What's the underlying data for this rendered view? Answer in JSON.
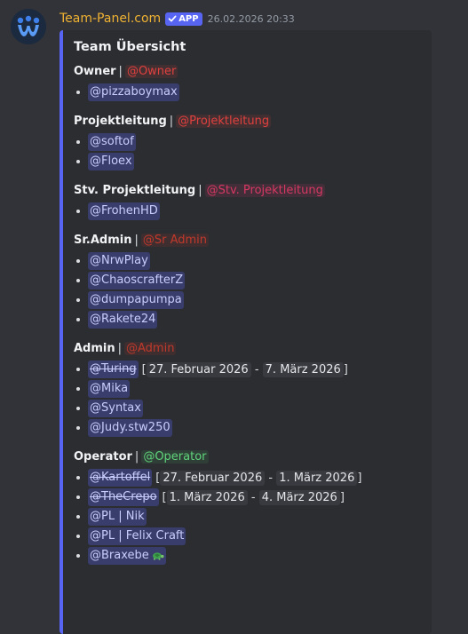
{
  "message": {
    "username": "Team-Panel.com",
    "app_badge": "APP",
    "timestamp": "26.02.2026 20:33"
  },
  "embed": {
    "title": "Team Übersicht",
    "accent_color": "#5865f2",
    "sections": [
      {
        "name": "Owner",
        "separator": "|",
        "role": "@Owner",
        "role_color": "#e0413f",
        "members": [
          {
            "mention": "@pizzaboymax"
          }
        ]
      },
      {
        "name": "Projektleitung",
        "separator": "|",
        "role": "@Projektleitung",
        "role_color": "#e0413f",
        "members": [
          {
            "mention": "@softof"
          },
          {
            "mention": "@Floex"
          }
        ]
      },
      {
        "name": "Stv. Projektleitung",
        "separator": "|",
        "role": "@Stv. Projektleitung",
        "role_color": "#d63863",
        "members": [
          {
            "mention": "@FrohenHD"
          }
        ]
      },
      {
        "name": "Sr.Admin",
        "separator": "|",
        "role": "@Sr Admin",
        "role_color": "#c0392b",
        "members": [
          {
            "mention": "@NrwPlay"
          },
          {
            "mention": "@ChaoscrafterZ"
          },
          {
            "mention": "@dumpapumpa"
          },
          {
            "mention": "@Rakete24"
          }
        ]
      },
      {
        "name": "Admin",
        "separator": "|",
        "role": "@Admin",
        "role_color": "#c0392b",
        "members": [
          {
            "mention": "@Turing",
            "struck": true,
            "from": "27. Februar 2026",
            "dash": "-",
            "to": "7. März 2026"
          },
          {
            "mention": "@Mika"
          },
          {
            "mention": "@Syntax"
          },
          {
            "mention": "@Judy.stw250"
          }
        ]
      },
      {
        "name": "Operator",
        "separator": "|",
        "role": "@Operator",
        "role_color": "#5fd57a",
        "members": [
          {
            "mention": "@Kartoffel",
            "struck": true,
            "from": "27. Februar 2026",
            "dash": "-",
            "to": "1. März 2026"
          },
          {
            "mention": "@TheCrepo",
            "struck": true,
            "from": "1. März 2026",
            "dash": "-",
            "to": "4. März 2026"
          },
          {
            "mention": "@PL | Nik"
          },
          {
            "mention": "@PL | Felix Craft"
          },
          {
            "mention": "@Braxebe",
            "emoji": "turtle-icon"
          }
        ]
      }
    ]
  }
}
